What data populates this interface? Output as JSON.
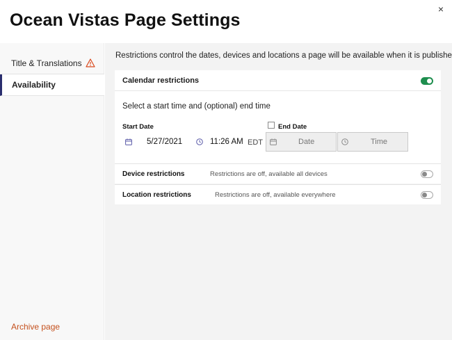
{
  "header": {
    "title": "Ocean Vistas Page Settings",
    "close_label": "×"
  },
  "sidebar": {
    "items": [
      {
        "label": "Title & Translations",
        "warning": true
      },
      {
        "label": "Availability",
        "active": true
      }
    ],
    "archive_label": "Archive page"
  },
  "main": {
    "intro": "Restrictions control the dates, devices and locations a page will be available when it is published",
    "calendar": {
      "title": "Calendar restrictions",
      "enabled": true,
      "subtitle": "Select a start time and (optional) end time",
      "start_label": "Start Date",
      "start_date": "5/27/2021",
      "start_time": "11:26 AM",
      "timezone": "EDT",
      "end_label": "End Date",
      "end_checked": false,
      "end_date_placeholder": "Date",
      "end_time_placeholder": "Time"
    },
    "device": {
      "title": "Device restrictions",
      "status": "Restrictions are off, available all devices",
      "enabled": false
    },
    "location": {
      "title": "Location restrictions",
      "status": "Restrictions are off, available everywhere",
      "enabled": false
    }
  },
  "colors": {
    "toggle_on": "#1e8e4e",
    "archive": "#c4501d",
    "warning": "#d9481c",
    "icon_accent": "#5a5aa8",
    "active_border": "#2a2e6e"
  }
}
